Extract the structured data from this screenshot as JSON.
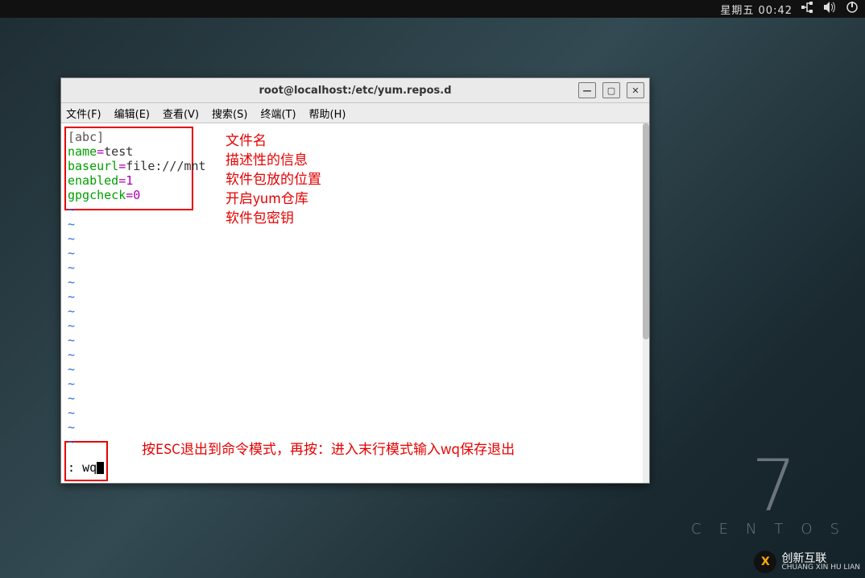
{
  "panel": {
    "clock": "星期五 00:42"
  },
  "centos": {
    "num": "7",
    "label": "CENTOS"
  },
  "watermark": {
    "logo_letter": "X",
    "main": "创新互联",
    "sub": "CHUANG XIN HU LIAN"
  },
  "window": {
    "title": "root@localhost:/etc/yum.repos.d",
    "menus": [
      "文件(F)",
      "编辑(E)",
      "查看(V)",
      "搜索(S)",
      "终端(T)",
      "帮助(H)"
    ]
  },
  "repo": {
    "section": "[abc]",
    "name_key": "name",
    "name_val": "test",
    "baseurl_key": "baseurl",
    "baseurl_val": "file:///mnt",
    "enabled_key": "enabled",
    "enabled_val": "1",
    "gpg_key": "gpgcheck",
    "gpg_val": "0"
  },
  "annotations": {
    "l1": "文件名",
    "l2": "描述性的信息",
    "l3": "软件包放的位置",
    "l4": "开启yum仓库",
    "l5": "软件包密钥",
    "bottom": "按ESC退出到命令模式，再按：进入末行模式输入wq保存退出"
  },
  "cmd": {
    "prompt": ":",
    "text": "wq"
  }
}
